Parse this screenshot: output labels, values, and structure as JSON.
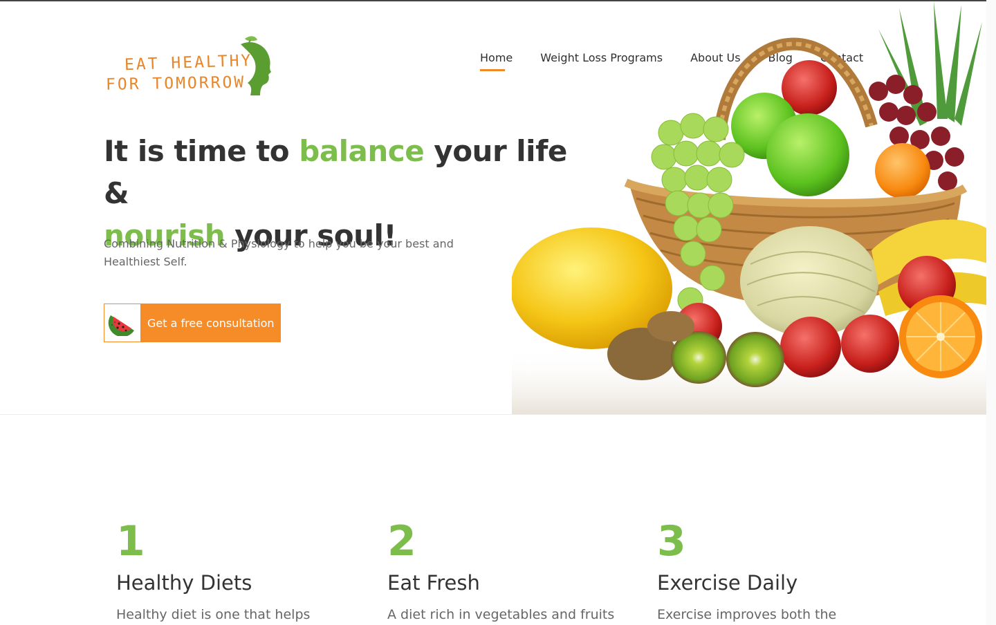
{
  "brand": {
    "line1": "EAT HEALTHY",
    "line2": "FOR TOMORROW",
    "colors": {
      "orange": "#e8862a",
      "green": "#5a9e32"
    }
  },
  "nav": {
    "items": [
      {
        "label": "Home",
        "active": true
      },
      {
        "label": "Weight Loss Programs",
        "active": false
      },
      {
        "label": "About Us",
        "active": false
      },
      {
        "label": "Blog",
        "active": false
      },
      {
        "label": "Contact",
        "active": false
      }
    ],
    "accent": "#f08a24"
  },
  "hero": {
    "headline_part1": "It is time to ",
    "headline_green1": "balance",
    "headline_part2": " your life & ",
    "headline_green2": "nourish",
    "headline_part3": " your soul!",
    "subtitle": "Combining Nutrition & Physiology to help you be your best and Healthiest Self.",
    "cta_label": "Get a free consultation",
    "cta_icon": "watermelon-icon",
    "image": "fruit-basket-image",
    "accent_green": "#7cbd4b",
    "cta_color": "#f58c28"
  },
  "features": [
    {
      "number": "1",
      "title": "Healthy Diets",
      "desc": "Healthy diet is one that helps"
    },
    {
      "number": "2",
      "title": "Eat Fresh",
      "desc": "A diet rich in vegetables and fruits"
    },
    {
      "number": "3",
      "title": "Exercise Daily",
      "desc": "Exercise improves both the"
    }
  ]
}
